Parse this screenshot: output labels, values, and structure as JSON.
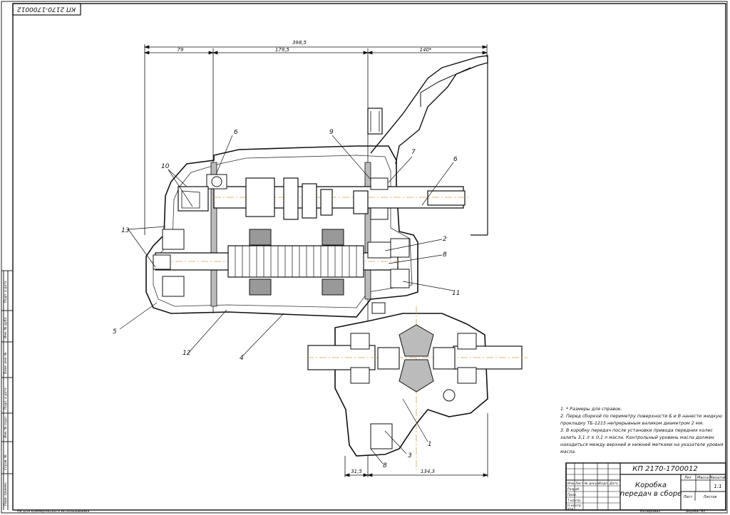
{
  "stamp_top": "КП 2170-1700012",
  "dimensions": {
    "overall": "398,5",
    "d79": "79",
    "d179": "179,5",
    "d140": "140*",
    "d31": "31,5",
    "d134": "134,3"
  },
  "callouts": [
    "6",
    "10",
    "13",
    "5",
    "12",
    "4",
    "9",
    "7",
    "6",
    "2",
    "8",
    "11",
    "1",
    "3",
    "8"
  ],
  "notes": [
    "1. * Размеры для справок.",
    "2. Перед сборкой по периметру поверхности Б и В нанести жидкую",
    "прокладку ТБ-1215 непрерывным валиком диаметром 2 мм.",
    "3. В коробку передач после установки привода передних колес",
    "залить 3,1 л ± 0,1 л масла. Контрольный уровень масла должен",
    "находиться между верхней и нижней метками на указателе уровня",
    "масла."
  ],
  "title_block": {
    "code": "КП 2170-1700012",
    "name_line1": "Коробка",
    "name_line2": "передач в сборе",
    "col_lit": "Лит",
    "col_mass": "Масса",
    "col_scale": "Масштаб",
    "scale_value": "1:1",
    "sheet": "Лист",
    "sheets": "Листов",
    "rows": [
      "Изм.",
      "Лист",
      "№ докум.",
      "Подп.",
      "Дата",
      "Разраб.",
      "Пров.",
      "Т.контр.",
      "Н.контр.",
      "Утв."
    ]
  },
  "footer": {
    "left": "Не для коммерческого использования",
    "copied": "Копировал",
    "format": "Формат",
    "format_value": "А1"
  },
  "side_labels": [
    "Подп. и дата",
    "Инв. № дубл.",
    "Взам. инв. №",
    "Подп. и дата",
    "Инв. № подл.",
    "Справ. №",
    "Перв. примен."
  ]
}
